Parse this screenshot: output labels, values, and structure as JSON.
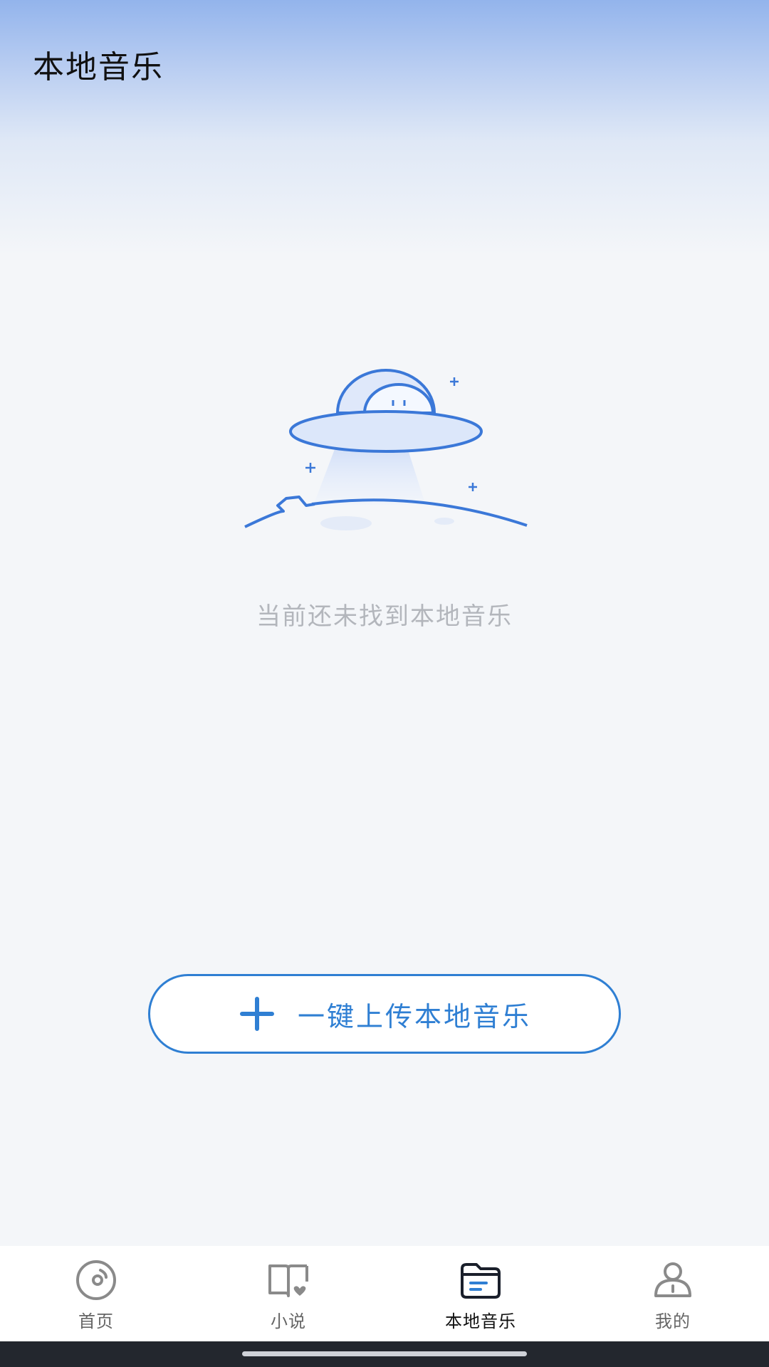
{
  "header": {
    "title": "本地音乐"
  },
  "empty_state": {
    "illustration": "ufo-illustration",
    "message": "当前还未找到本地音乐"
  },
  "upload_button": {
    "icon": "plus-icon",
    "label": "一键上传本地音乐"
  },
  "tab_bar": {
    "active_index": 2,
    "tabs": [
      {
        "label": "首页",
        "icon": "disc-icon"
      },
      {
        "label": "小说",
        "icon": "book-icon"
      },
      {
        "label": "本地音乐",
        "icon": "folder-icon"
      },
      {
        "label": "我的",
        "icon": "user-icon"
      }
    ]
  },
  "colors": {
    "accent": "#2f7fd3",
    "background": "#f4f6f9",
    "header_gradient_top": "#93b4ec",
    "muted_text": "#b3b6bc"
  }
}
